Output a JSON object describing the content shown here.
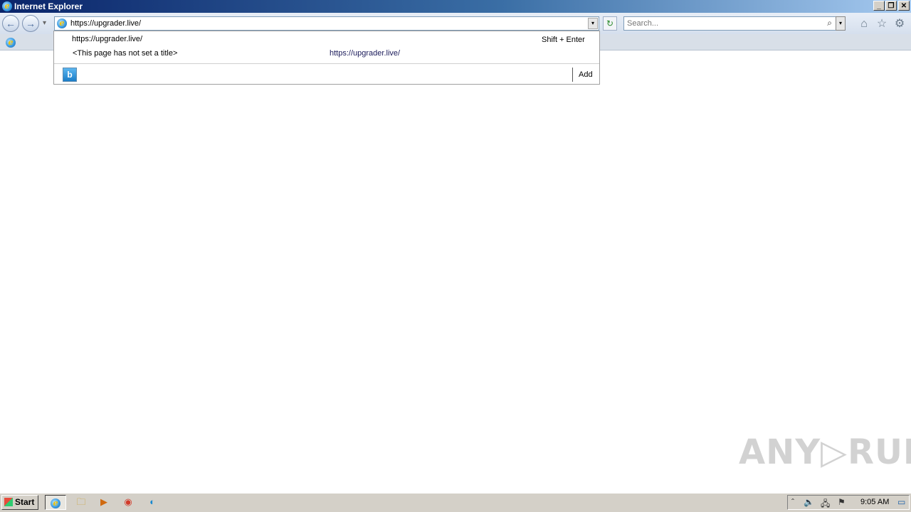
{
  "window": {
    "title": "Internet Explorer",
    "buttons": {
      "minimize": "_",
      "restore": "❐",
      "close": "✕"
    }
  },
  "toolbar": {
    "back": "←",
    "forward": "→",
    "history_dropdown": "▾",
    "address_value": "https://upgrader.live/",
    "address_dropdown": "▾",
    "refresh": "↻",
    "search_placeholder": "Search...",
    "search_icon": "⌕",
    "search_dropdown": "▾",
    "home_icon": "⌂",
    "favorites_icon": "☆",
    "tools_icon": "⚙"
  },
  "suggestions": {
    "items": [
      {
        "title": "https://upgrader.live/",
        "hint": "Shift + Enter"
      },
      {
        "title": "<This page has not set a title>",
        "url": "https://upgrader.live/"
      }
    ],
    "bing_label": "b",
    "add_label": "Add"
  },
  "watermark": "ANY▷RUN",
  "taskbar": {
    "start_label": "Start",
    "items": [
      {
        "name": "taskbar-ie",
        "glyph": "e"
      },
      {
        "name": "taskbar-explorer",
        "glyph": "🗀"
      },
      {
        "name": "taskbar-media",
        "glyph": "▶"
      },
      {
        "name": "taskbar-chrome",
        "glyph": "◉"
      },
      {
        "name": "taskbar-edge",
        "glyph": "◐"
      }
    ],
    "tray": {
      "chevron": "ˆ",
      "volume": "🔈",
      "network": "🖧",
      "flag": "⚑",
      "clock": "9:05 AM",
      "desktop": "▭"
    }
  },
  "colors": {
    "titlebar_start": "#0a246a",
    "titlebar_end": "#a6caf0",
    "taskbar": "#d4d0c8"
  }
}
